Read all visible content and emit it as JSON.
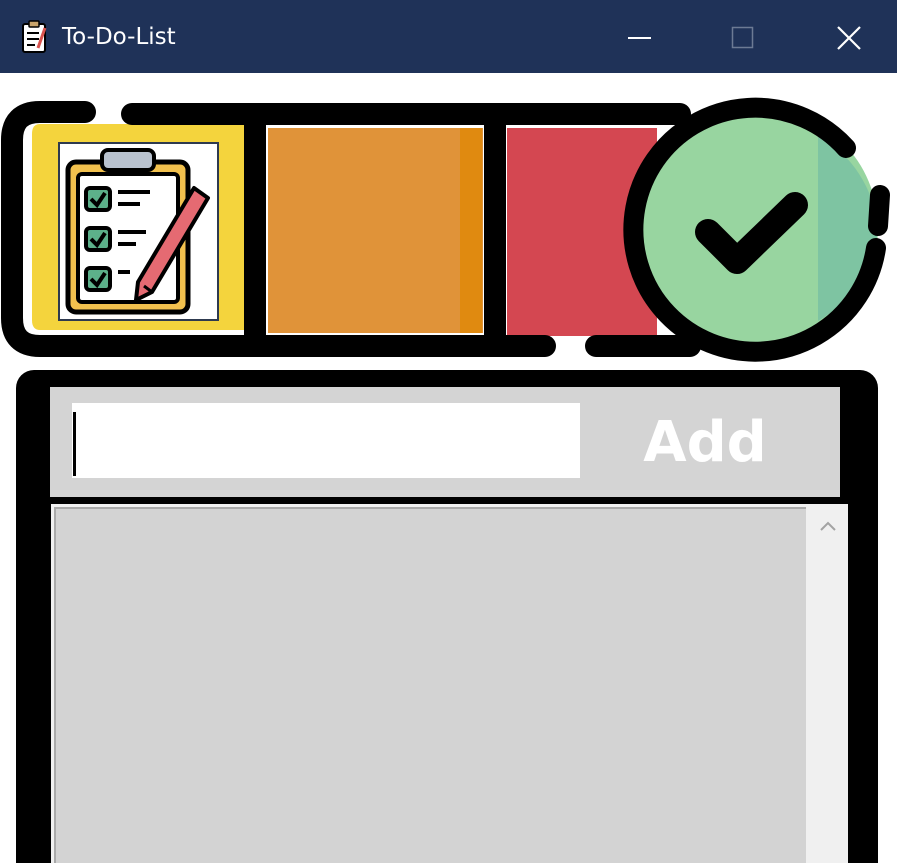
{
  "window": {
    "title": "To-Do-List",
    "icons": {
      "app": "clipboard-icon",
      "minimize": "minimize-icon",
      "maximize": "maximize-icon",
      "close": "close-icon"
    },
    "titlebar_color": "#1f3258"
  },
  "banner": {
    "icons": [
      "clipboard-checklist-icon",
      "checkmark-circle-icon"
    ],
    "colors": {
      "yellow": "#f4d43d",
      "orange": "#e09339",
      "red": "#d44751",
      "green": "#98d5a0"
    }
  },
  "entry": {
    "input_value": "",
    "add_label": "Add"
  },
  "task_list": {
    "items": [],
    "scrollbar_icon": "chevron-up-icon"
  }
}
